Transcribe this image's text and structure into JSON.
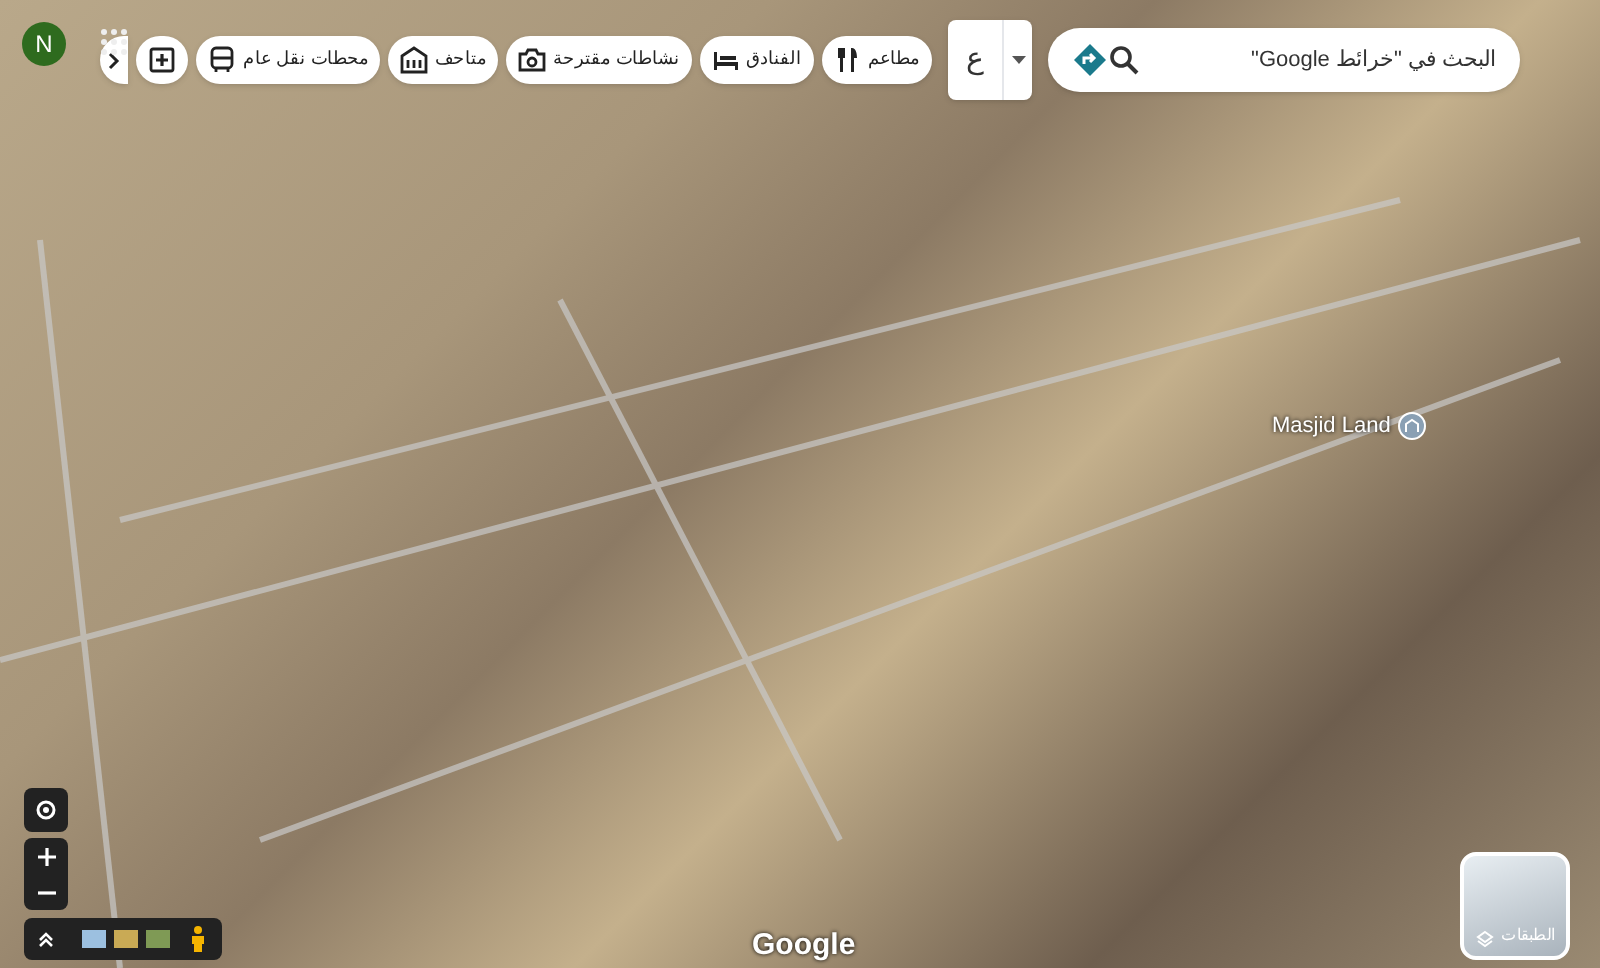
{
  "search": {
    "placeholder": "البحث في \"خرائط Google\""
  },
  "language_button": {
    "label": "ع"
  },
  "categories": [
    {
      "label": "مطاعم",
      "kind": "restaurant"
    },
    {
      "label": "الفنادق",
      "kind": "hotel"
    },
    {
      "label": "نشاطات مقترحة",
      "kind": "camera"
    },
    {
      "label": "متاحف",
      "kind": "museum"
    },
    {
      "label": "محطات نقل عام",
      "kind": "transit"
    },
    {
      "kind": "pharmacy"
    }
  ],
  "account": {
    "initial": "N"
  },
  "map_labels": [
    {
      "label": "Masjid Land"
    }
  ],
  "layers": {
    "label": "الطبقات"
  },
  "attribution": {
    "label": "Google"
  }
}
